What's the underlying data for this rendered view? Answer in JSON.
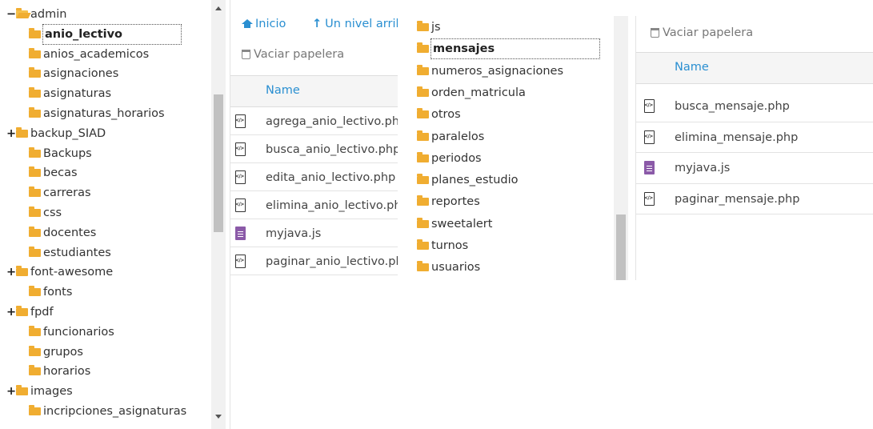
{
  "left_tree": {
    "items": [
      {
        "label": "admin",
        "toggle": "−",
        "open": true
      },
      {
        "label": "anio_lectivo",
        "toggle": "",
        "selected": true
      },
      {
        "label": "anios_academicos",
        "toggle": ""
      },
      {
        "label": "asignaciones",
        "toggle": ""
      },
      {
        "label": "asignaturas",
        "toggle": ""
      },
      {
        "label": "asignaturas_horarios",
        "toggle": ""
      },
      {
        "label": "backup_SIAD",
        "toggle": "+"
      },
      {
        "label": "Backups",
        "toggle": ""
      },
      {
        "label": "becas",
        "toggle": ""
      },
      {
        "label": "carreras",
        "toggle": ""
      },
      {
        "label": "css",
        "toggle": ""
      },
      {
        "label": "docentes",
        "toggle": ""
      },
      {
        "label": "estudiantes",
        "toggle": ""
      },
      {
        "label": "font-awesome",
        "toggle": "+"
      },
      {
        "label": "fonts",
        "toggle": ""
      },
      {
        "label": "fpdf",
        "toggle": "+"
      },
      {
        "label": "funcionarios",
        "toggle": ""
      },
      {
        "label": "grupos",
        "toggle": ""
      },
      {
        "label": "horarios",
        "toggle": ""
      },
      {
        "label": "images",
        "toggle": "+"
      },
      {
        "label": "incripciones_asignaturas",
        "toggle": ""
      }
    ]
  },
  "middle_files": {
    "home_label": "Inicio",
    "up_label": "Un nivel arrib",
    "trash_label": "Vaciar papelera",
    "column_name": "Name",
    "files": [
      {
        "name": "agrega_anio_lectivo.php",
        "type": "php"
      },
      {
        "name": "busca_anio_lectivo.php",
        "type": "php"
      },
      {
        "name": "edita_anio_lectivo.php",
        "type": "php"
      },
      {
        "name": "elimina_anio_lectivo.php",
        "type": "php"
      },
      {
        "name": "myjava.js",
        "type": "js"
      },
      {
        "name": "paginar_anio_lectivo.php",
        "type": "php"
      }
    ]
  },
  "center_tree": {
    "items": [
      {
        "label": "js"
      },
      {
        "label": "mensajes",
        "selected": true
      },
      {
        "label": "numeros_asignaciones"
      },
      {
        "label": "orden_matricula"
      },
      {
        "label": "otros"
      },
      {
        "label": "paralelos"
      },
      {
        "label": "periodos"
      },
      {
        "label": "planes_estudio"
      },
      {
        "label": "reportes"
      },
      {
        "label": "sweetalert"
      },
      {
        "label": "turnos"
      },
      {
        "label": "usuarios"
      }
    ]
  },
  "right_files": {
    "trash_label": "Vaciar papelera",
    "column_name": "Name",
    "files": [
      {
        "name": "busca_mensaje.php",
        "type": "php"
      },
      {
        "name": "elimina_mensaje.php",
        "type": "php"
      },
      {
        "name": "myjava.js",
        "type": "js"
      },
      {
        "name": "paginar_mensaje.php",
        "type": "php"
      }
    ]
  }
}
